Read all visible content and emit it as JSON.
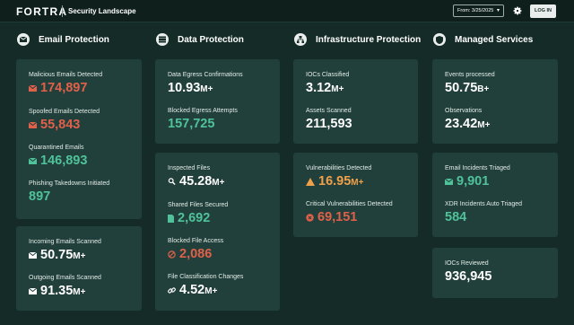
{
  "header": {
    "logo": "FORTRA",
    "title": "Security Landscape",
    "date_label": "From: 3/25/2025",
    "login_label": "LOG IN"
  },
  "colors": {
    "red": "#e0604a",
    "green": "#4fc29a",
    "orange": "#f0a04a",
    "white": "#ffffff"
  },
  "sections": {
    "email": {
      "title": "Email Protection",
      "icon": "envelope-icon"
    },
    "data": {
      "title": "Data Protection",
      "icon": "database-icon"
    },
    "infra": {
      "title": "Infrastructure Protection",
      "icon": "network-icon"
    },
    "managed": {
      "title": "Managed Services",
      "icon": "shield-icon"
    }
  },
  "metrics": {
    "malicious": {
      "label": "Malicious Emails Detected",
      "value": "174,897",
      "icon": "envelope-icon"
    },
    "spoofed": {
      "label": "Spoofed Emails Detected",
      "value": "55,843",
      "icon": "envelope-icon"
    },
    "quarantined": {
      "label": "Quarantined Emails",
      "value": "146,893",
      "icon": "envelope-icon"
    },
    "phishing": {
      "label": "Phishing Takedowns Initiated",
      "value": "897"
    },
    "incoming": {
      "label": "Incoming Emails Scanned",
      "value": "50.75",
      "suffix": "M+",
      "icon": "envelope-icon"
    },
    "outgoing": {
      "label": "Outgoing Emails Scanned",
      "value": "91.35",
      "suffix": "M+",
      "icon": "envelope-icon"
    },
    "egress_conf": {
      "label": "Data Egress Confirmations",
      "value": "10.93",
      "suffix": "M+"
    },
    "egress_blocked": {
      "label": "Blocked Egress Attempts",
      "value": "157,725"
    },
    "inspected": {
      "label": "Inspected Files",
      "value": "45.28",
      "suffix": "M+",
      "icon": "search-icon"
    },
    "shared": {
      "label": "Shared Files Secured",
      "value": "2,692",
      "icon": "file-icon"
    },
    "blocked_file": {
      "label": "Blocked File Access",
      "value": "2,086",
      "icon": "block-icon"
    },
    "classification": {
      "label": "File Classification Changes",
      "value": "4.52",
      "suffix": "M+",
      "icon": "link-icon"
    },
    "iocs": {
      "label": "IOCs Classified",
      "value": "3.12",
      "suffix": "M+"
    },
    "assets": {
      "label": "Assets Scanned",
      "value": "211,593"
    },
    "vulns": {
      "label": "Vulnerabilities Detected",
      "value": "16.95",
      "suffix": "M+",
      "icon": "warning-icon"
    },
    "critical": {
      "label": "Critical Vulnerabilities Detected",
      "value": "69,151",
      "icon": "alert-circle-icon"
    },
    "events": {
      "label": "Events processed",
      "value": "50.75",
      "suffix": "B+"
    },
    "observations": {
      "label": "Observations",
      "value": "23.42",
      "suffix": "M+"
    },
    "email_incidents": {
      "label": "Email Incidents Triaged",
      "value": "9,901",
      "icon": "envelope-icon"
    },
    "xdr": {
      "label": "XDR Incidents Auto Triaged",
      "value": "584"
    },
    "iocs_reviewed": {
      "label": "IOCs Reviewed",
      "value": "936,945"
    }
  }
}
